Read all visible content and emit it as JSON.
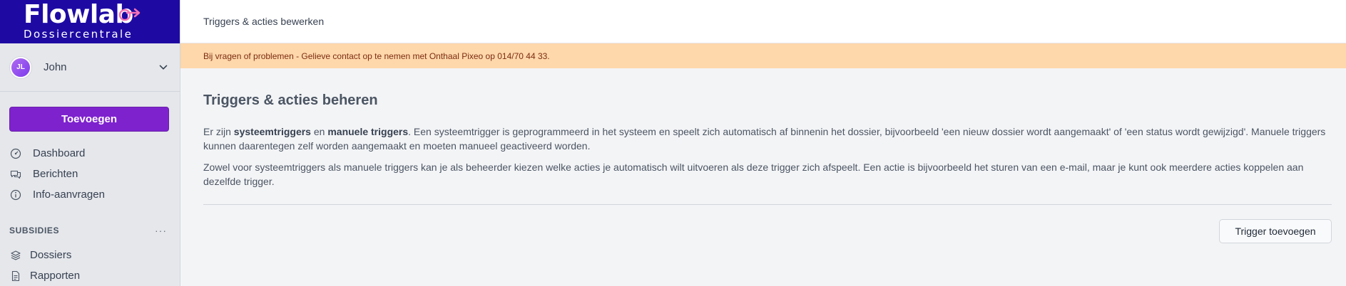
{
  "brand": {
    "title": "Flowlab",
    "subtitle": "Dossiercentrale",
    "color": "#1e0aa3"
  },
  "user": {
    "initials": "JL",
    "name": "John"
  },
  "sidebar": {
    "add_button": "Toevoegen",
    "items": [
      {
        "label": "Dashboard",
        "icon": "dashboard-icon"
      },
      {
        "label": "Berichten",
        "icon": "chat-icon"
      },
      {
        "label": "Info-aanvragen",
        "icon": "info-icon"
      }
    ],
    "section": {
      "label": "SUBSIDIES",
      "more": "···",
      "items": [
        {
          "label": "Dossiers",
          "icon": "stack-icon"
        },
        {
          "label": "Rapporten",
          "icon": "document-icon"
        }
      ]
    }
  },
  "header": {
    "breadcrumb": "Triggers & acties bewerken"
  },
  "banner": {
    "text": "Bij vragen of problemen - Gelieve contact op te nemen met Onthaal Pixeo op 014/70 44 33.",
    "color": "#fed7aa"
  },
  "main": {
    "title": "Triggers & acties beheren",
    "p1_a": "Er zijn ",
    "p1_b": "systeemtriggers",
    "p1_c": " en ",
    "p1_d": "manuele triggers",
    "p1_e": ". Een systeemtrigger is geprogrammeerd in het systeem en speelt zich automatisch af binnenin het dossier, bijvoorbeeld 'een nieuw dossier wordt aangemaakt' of 'een status wordt gewijzigd'. Manuele triggers kunnen daarentegen zelf worden aangemaakt en moeten manueel geactiveerd worden.",
    "p2": "Zowel voor systeemtriggers als manuele triggers kan je als beheerder kiezen welke acties je automatisch wilt uitvoeren als deze trigger zich afspeelt. Een actie is bijvoorbeeld het sturen van een e-mail, maar je kunt ook meerdere acties koppelen aan dezelfde trigger.",
    "trigger_button": "Trigger toevoegen"
  },
  "accent": "#7e22ce"
}
